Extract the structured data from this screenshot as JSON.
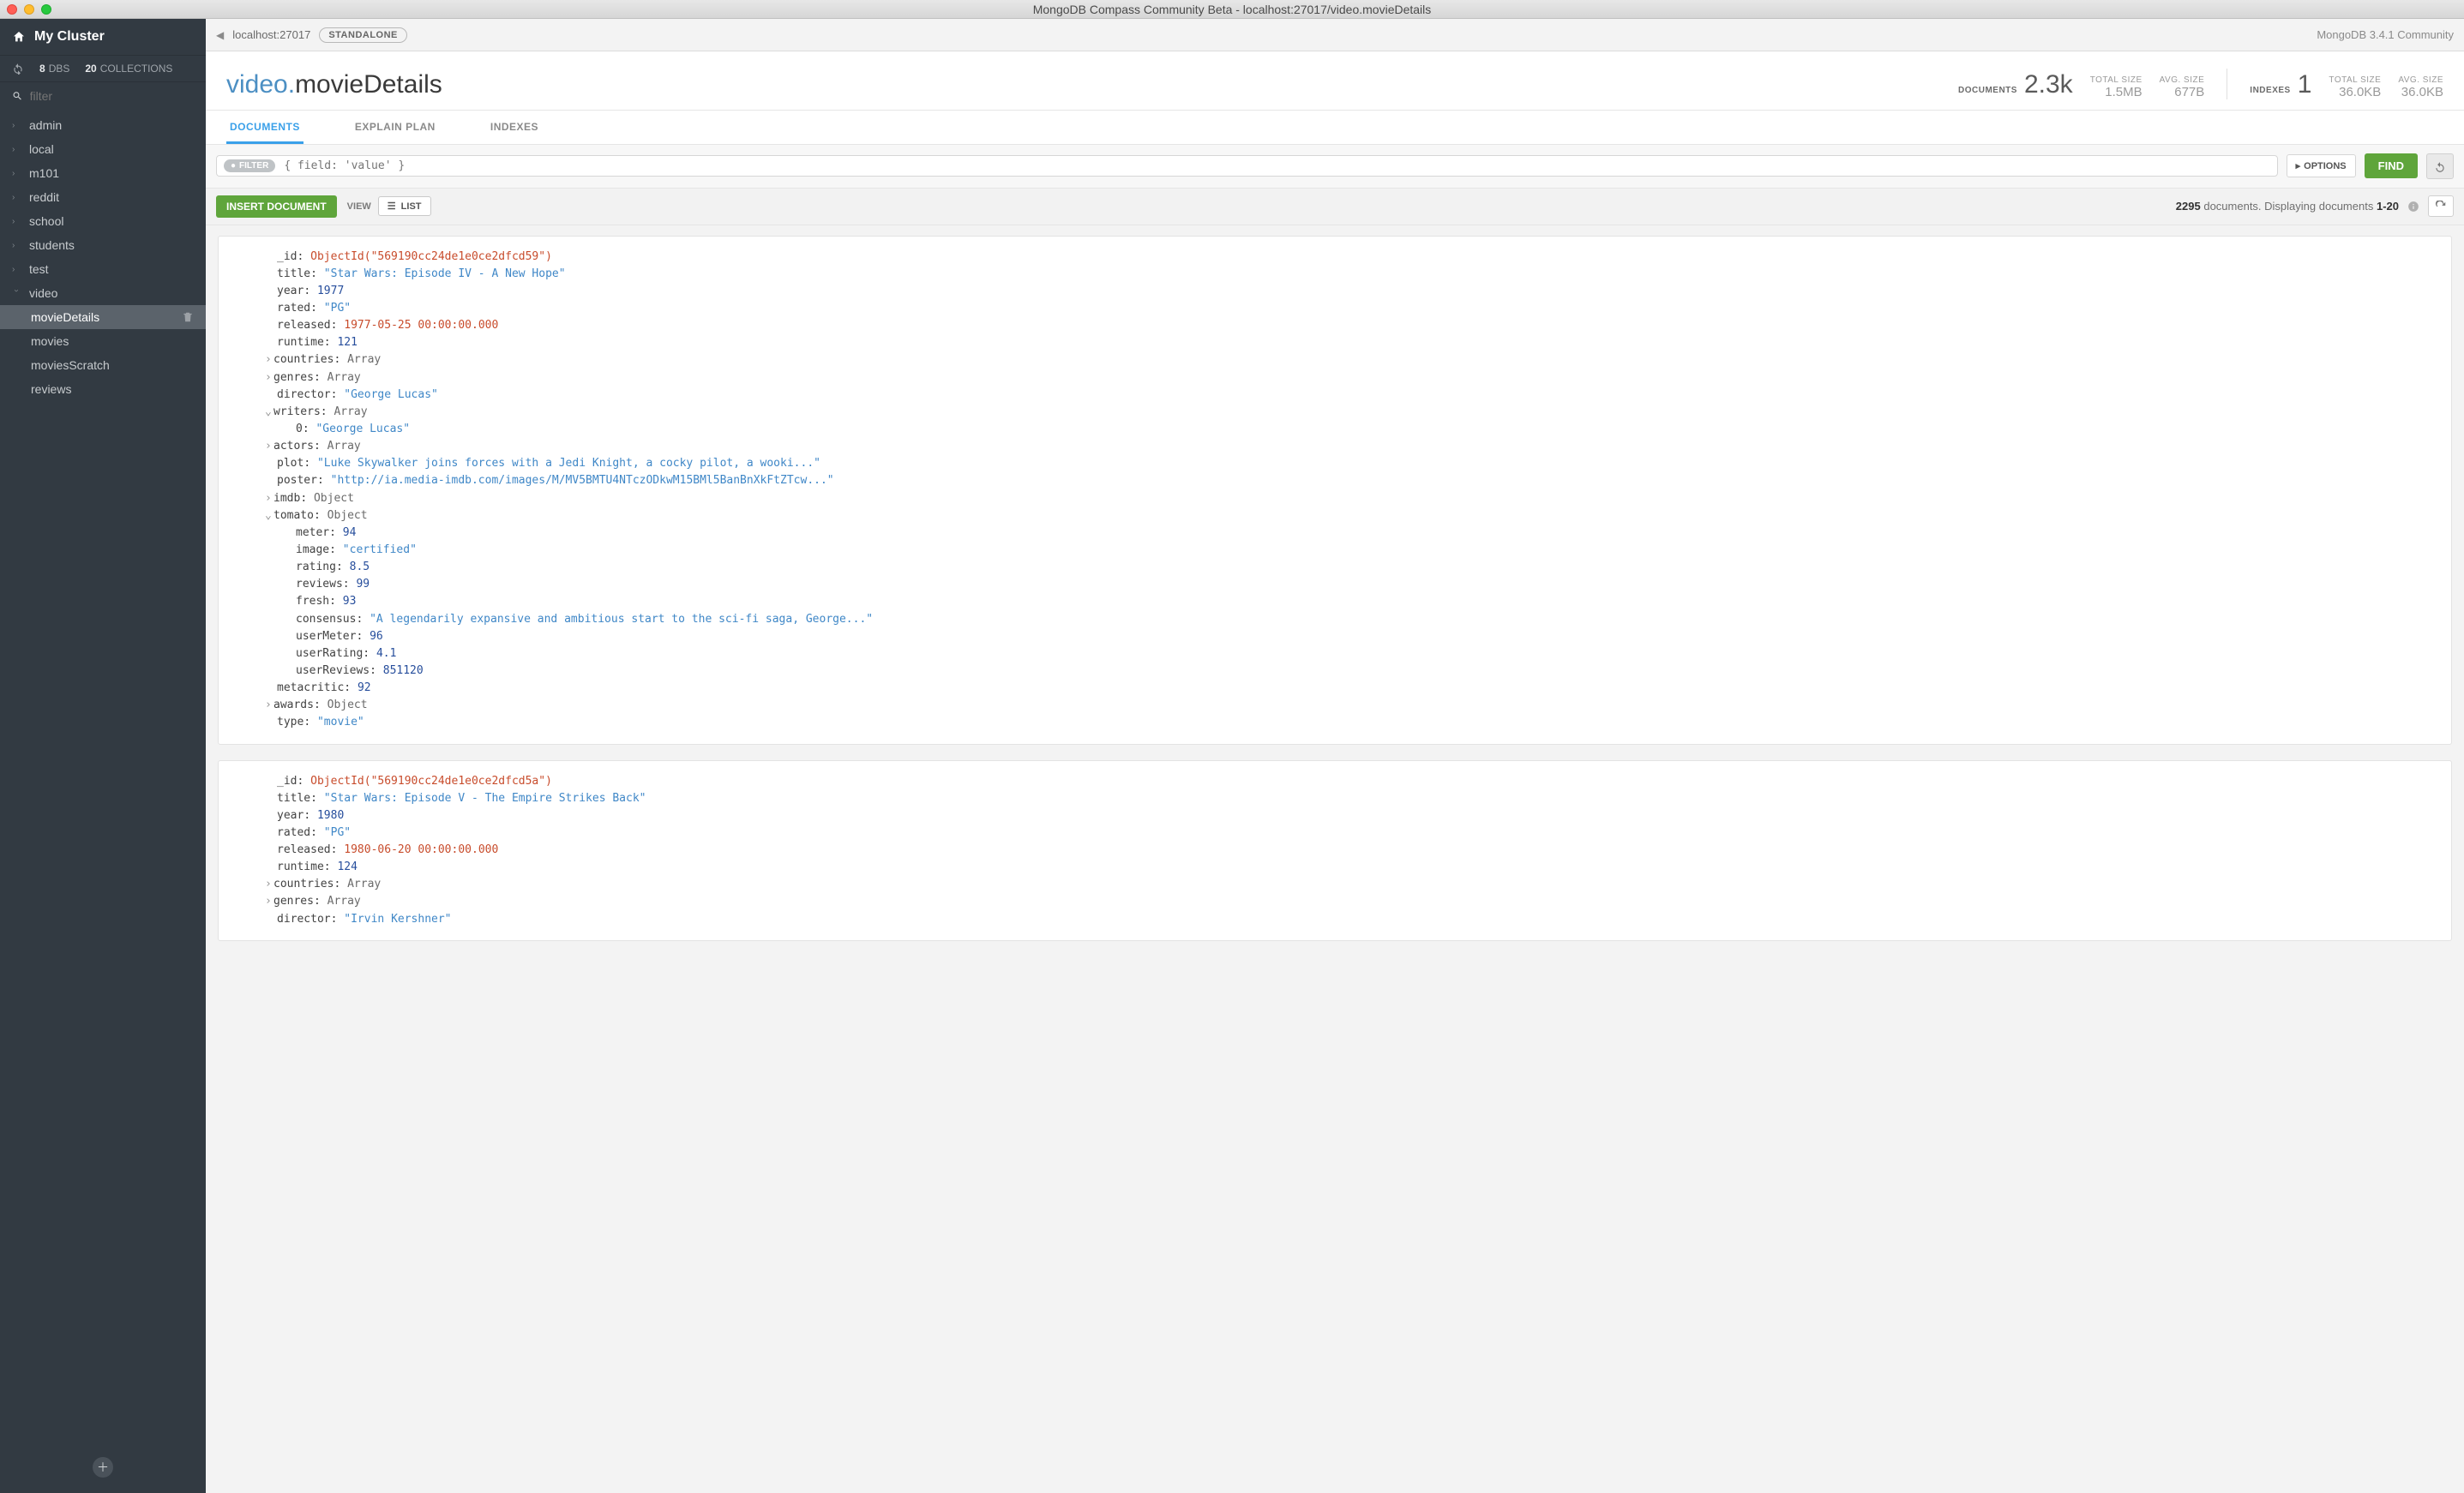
{
  "window": {
    "title": "MongoDB Compass Community Beta - localhost:27017/video.movieDetails"
  },
  "sidebar": {
    "cluster": "My Cluster",
    "dbs_num": "8",
    "dbs_lbl": "DBS",
    "coll_num": "20",
    "coll_lbl": "COLLECTIONS",
    "filter_ph": "filter",
    "dbs": [
      {
        "name": "admin"
      },
      {
        "name": "local"
      },
      {
        "name": "m101"
      },
      {
        "name": "reddit"
      },
      {
        "name": "school"
      },
      {
        "name": "students"
      },
      {
        "name": "test"
      }
    ],
    "expanded": {
      "name": "video",
      "items": [
        "movieDetails",
        "movies",
        "moviesScratch",
        "reviews"
      ]
    }
  },
  "topbar": {
    "host": "localhost:27017",
    "standalone": "STANDALONE",
    "right": "MongoDB 3.4.1 Community"
  },
  "ns": {
    "db": "video",
    "coll": "movieDetails"
  },
  "tabs": {
    "documents": "DOCUMENTS",
    "explain": "EXPLAIN PLAN",
    "indexes": "INDEXES"
  },
  "stats": {
    "documents_lbl": "DOCUMENTS",
    "documents_val": "2.3k",
    "doc_total_lbl": "TOTAL SIZE",
    "doc_total_val": "1.5MB",
    "doc_avg_lbl": "AVG. SIZE",
    "doc_avg_val": "677B",
    "indexes_lbl": "INDEXES",
    "indexes_val": "1",
    "idx_total_lbl": "TOTAL SIZE",
    "idx_total_val": "36.0KB",
    "idx_avg_lbl": "AVG. SIZE",
    "idx_avg_val": "36.0KB"
  },
  "filter": {
    "badge": "FILTER",
    "placeholder": "{ field: 'value' }",
    "options": "OPTIONS",
    "find": "FIND"
  },
  "action": {
    "insert": "INSERT DOCUMENT",
    "view": "VIEW",
    "list": "LIST",
    "pager_count": "2295",
    "pager_text": "documents. Displaying documents",
    "pager_range": "1-20"
  },
  "doc1": {
    "_id": "ObjectId(\"569190cc24de1e0ce2dfcd59\")",
    "title": "\"Star Wars: Episode IV - A New Hope\"",
    "year": "1977",
    "rated": "\"PG\"",
    "released": "1977-05-25 00:00:00.000",
    "runtime": "121",
    "countries": "Array",
    "genres": "Array",
    "director": "\"George Lucas\"",
    "writers": "Array",
    "writers0": "\"George Lucas\"",
    "actors": "Array",
    "plot": "\"Luke Skywalker joins forces with a Jedi Knight, a cocky pilot, a wooki...\"",
    "poster": "\"http://ia.media-imdb.com/images/M/MV5BMTU4NTczODkwM15BMl5BanBnXkFtZTcw...\"",
    "imdb": "Object",
    "tomato": "Object",
    "t_meter": "94",
    "t_image": "\"certified\"",
    "t_rating": "8.5",
    "t_reviews": "99",
    "t_fresh": "93",
    "t_consensus": "\"A legendarily expansive and ambitious start to the sci-fi saga, George...\"",
    "t_userMeter": "96",
    "t_userRating": "4.1",
    "t_userReviews": "851120",
    "metacritic": "92",
    "awards": "Object",
    "type": "\"movie\""
  },
  "doc2": {
    "_id": "ObjectId(\"569190cc24de1e0ce2dfcd5a\")",
    "title": "\"Star Wars: Episode V - The Empire Strikes Back\"",
    "year": "1980",
    "rated": "\"PG\"",
    "released": "1980-06-20 00:00:00.000",
    "runtime": "124",
    "countries": "Array",
    "genres": "Array",
    "director": "\"Irvin Kershner\""
  }
}
